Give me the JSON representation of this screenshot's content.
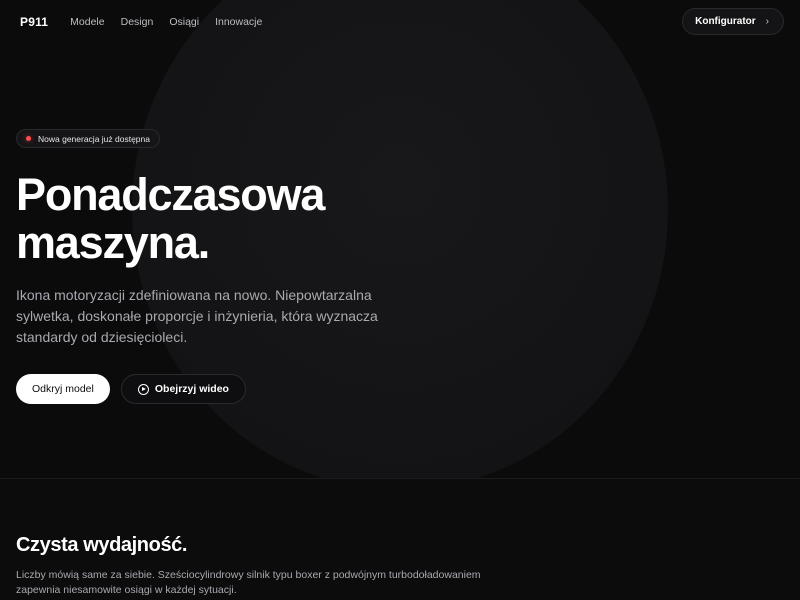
{
  "nav": {
    "logo": "P911",
    "links": [
      "Modele",
      "Design",
      "Osiągi",
      "Innowacje"
    ],
    "cta_label": "Konfigurator",
    "cta_icon": "chevron-right-icon"
  },
  "hero": {
    "badge": "Nowa generacja już dostępna",
    "title_line1": "Ponadczasowa",
    "title_line2": "maszyna.",
    "description": "Ikona motoryzacji zdefiniowana na nowo. Niepowtarzalna sylwetka, doskonałe proporcje i inżynieria, która wyznacza standardy od dziesięcioleci.",
    "primary_button": "Odkryj model",
    "secondary_button": "Obejrzyj wideo",
    "secondary_icon": "play-circle-icon"
  },
  "performance": {
    "title": "Czysta wydajność.",
    "text": "Liczby mówią same za siebie. Sześciocylindrowy silnik typu boxer z podwójnym turbodoładowaniem zapewnia niesamowite osiągi w każdej sytuacji."
  },
  "colors": {
    "background": "#0b0b0c",
    "badge_dot": "#ff4a4a",
    "text_primary": "#ffffff",
    "text_muted": "#a9a9b0"
  }
}
